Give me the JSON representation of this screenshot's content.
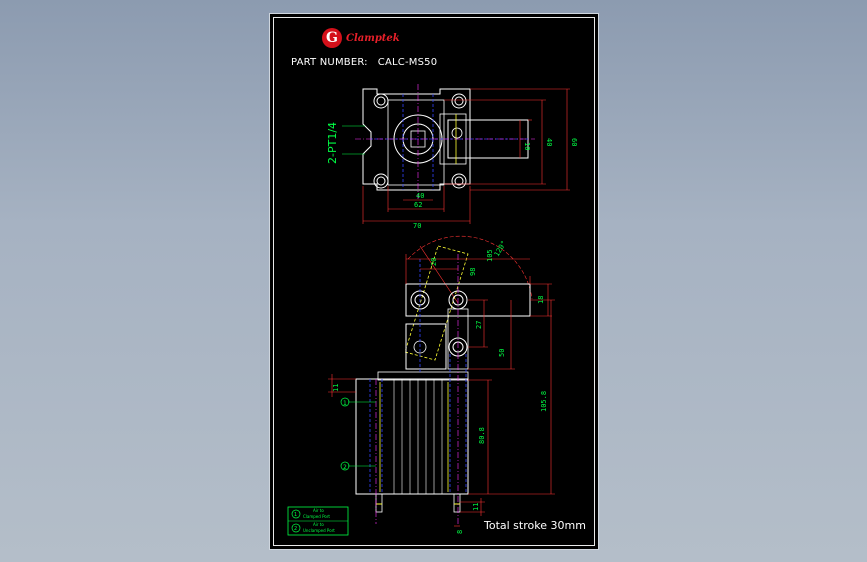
{
  "brand": {
    "mark": "G",
    "name": "Clamptek"
  },
  "part": {
    "label": "PART NUMBER:",
    "value": "CALC-MS50"
  },
  "port_note": "2-PT1/4",
  "stroke_note": "Total stroke 30mm",
  "legend": [
    {
      "num": "1",
      "line1": "Air to",
      "line2": "Clamped Port"
    },
    {
      "num": "2",
      "line1": "Air to",
      "line2": "Unclamped Port"
    }
  ],
  "top_view_dims": {
    "d1": "40",
    "d2": "62",
    "d3": "70",
    "r1": "10",
    "r2": "40",
    "r3": "60"
  },
  "side_view_dims": {
    "a1": "20",
    "a2": "98",
    "a3": "105",
    "angle": "120°",
    "h1": "18",
    "h2": "27",
    "h3": "50",
    "h4": "105.8",
    "h5": "80.8",
    "b1": "11",
    "b2": "11",
    "b3": "8"
  },
  "port_markers": [
    "1",
    "2"
  ],
  "colors": {
    "sheet": "#000000",
    "line": "#ffffff",
    "dim": "#ff0000",
    "hidden": "#0000ff",
    "center": "#ff00ff",
    "note": "#00ff00",
    "accent": "#ffff00"
  }
}
